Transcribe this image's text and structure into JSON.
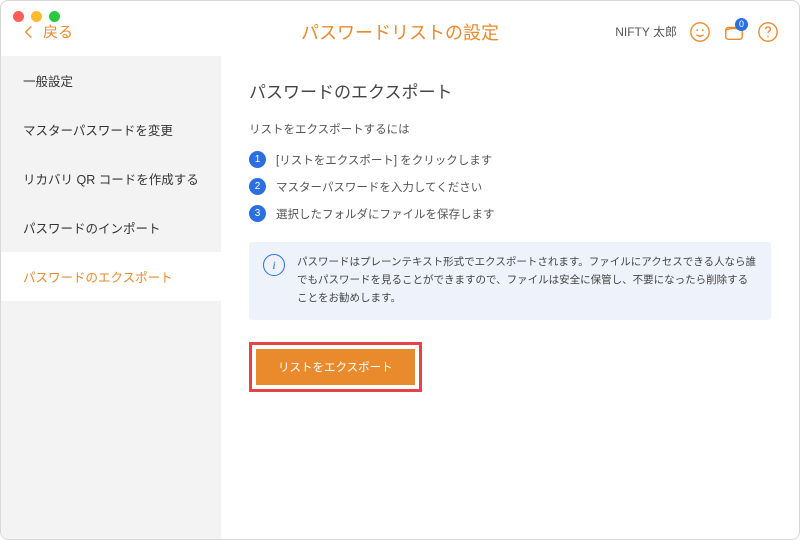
{
  "header": {
    "back_label": "戻る",
    "title": "パスワードリストの設定",
    "username": "NIFTY 太郎",
    "badge_count": "0"
  },
  "sidebar": {
    "items": [
      {
        "label": "一般設定"
      },
      {
        "label": "マスターパスワードを変更"
      },
      {
        "label": "リカバリ QR コードを作成する"
      },
      {
        "label": "パスワードのインポート"
      },
      {
        "label": "パスワードのエクスポート"
      }
    ]
  },
  "content": {
    "heading": "パスワードのエクスポート",
    "subheading": "リストをエクスポートするには",
    "steps": [
      "[リストをエクスポート] をクリックします",
      "マスターパスワードを入力してください",
      "選択したフォルダにファイルを保存します"
    ],
    "info_text": "パスワードはプレーンテキスト形式でエクスポートされます。ファイルにアクセスできる人なら誰でもパスワードを見ることができますので、ファイルは安全に保管し、不要になったら削除することをお勧めします。",
    "export_button": "リストをエクスポート"
  }
}
